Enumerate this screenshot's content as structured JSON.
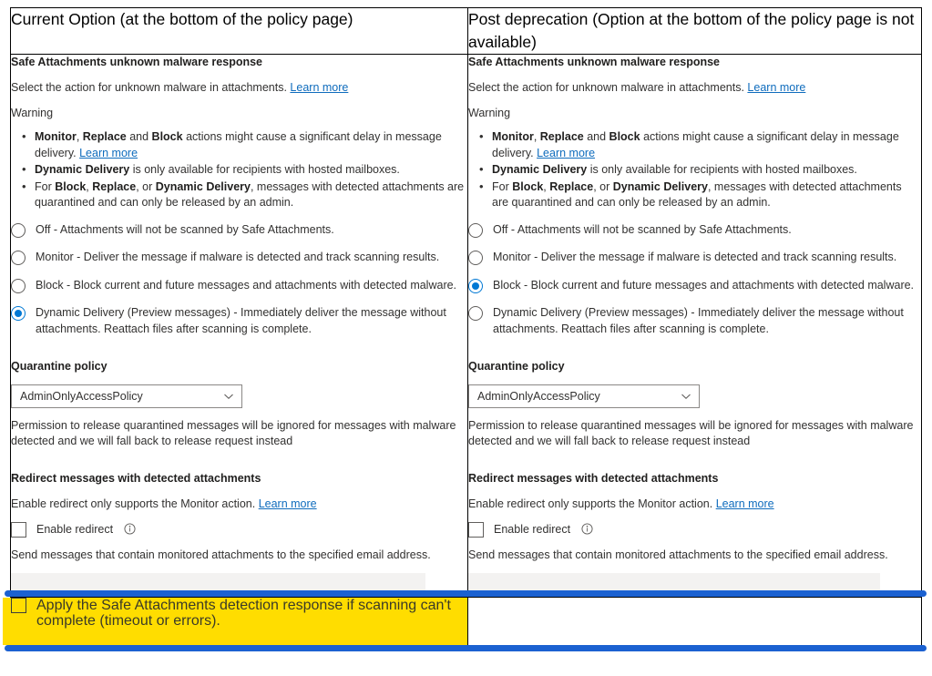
{
  "comparison": {
    "columns": [
      {
        "header": "Current Option (at the bottom of the policy page)"
      },
      {
        "header": "Post deprecation (Option at the bottom of the policy page is not available)"
      }
    ]
  },
  "panel": {
    "section_title": "Safe Attachments unknown malware response",
    "description": "Select the action for unknown malware in attachments.",
    "learn_more": "Learn more",
    "warning_label": "Warning",
    "warning_bullets": [
      {
        "parts": [
          {
            "text": "Monitor",
            "bold": true
          },
          {
            "text": ", ",
            "bold": false
          },
          {
            "text": "Replace",
            "bold": true
          },
          {
            "text": " and ",
            "bold": false
          },
          {
            "text": "Block",
            "bold": true
          },
          {
            "text": " actions might cause a significant delay in message delivery. ",
            "bold": false
          }
        ],
        "link": "Learn more"
      },
      {
        "parts": [
          {
            "text": "Dynamic Delivery",
            "bold": true
          },
          {
            "text": " is only available for recipients with hosted mailboxes.",
            "bold": false
          }
        ],
        "link": ""
      },
      {
        "parts": [
          {
            "text": "For ",
            "bold": false
          },
          {
            "text": "Block",
            "bold": true
          },
          {
            "text": ", ",
            "bold": false
          },
          {
            "text": "Replace",
            "bold": true
          },
          {
            "text": ", or ",
            "bold": false
          },
          {
            "text": "Dynamic Delivery",
            "bold": true
          },
          {
            "text": ", messages with detected attachments are quarantined and can only be released by an admin.",
            "bold": false
          }
        ],
        "link": ""
      }
    ],
    "radio_options": [
      "Off - Attachments will not be scanned by Safe Attachments.",
      "Monitor - Deliver the message if malware is detected and track scanning results.",
      "Block - Block current and future messages and attachments with detected malware.",
      "Dynamic Delivery (Preview messages) - Immediately deliver the message without attachments. Reattach files after scanning is complete."
    ],
    "quarantine_title": "Quarantine policy",
    "quarantine_value": "AdminOnlyAccessPolicy",
    "quarantine_note": "Permission to release quarantined messages will be ignored for messages with malware detected and we will fall back to release request instead",
    "redirect_title": "Redirect messages with detected attachments",
    "redirect_description": "Enable redirect only supports the Monitor action.",
    "redirect_learn_more": "Learn more",
    "redirect_checkbox_label": "Enable redirect",
    "redirect_note": "Send messages that contain monitored attachments to the specified email address.",
    "redirect_email_value": ""
  },
  "left_column": {
    "selected_radio_index": 3
  },
  "right_column": {
    "selected_radio_index": 2
  },
  "highlight": {
    "checkbox_label": "Apply the Safe Attachments detection response if scanning can't complete (timeout or errors).",
    "checked": false,
    "background_color": "#ffdd00",
    "annotation_color": "#1b61d1"
  },
  "colors": {
    "link": "#0f6cbd",
    "accent": "#0078d4",
    "text": "#323130",
    "input_disabled": "#f3f2f1",
    "border": "#000000"
  },
  "icons": {
    "chevron": "chevron-down-icon",
    "info": "info-icon"
  }
}
